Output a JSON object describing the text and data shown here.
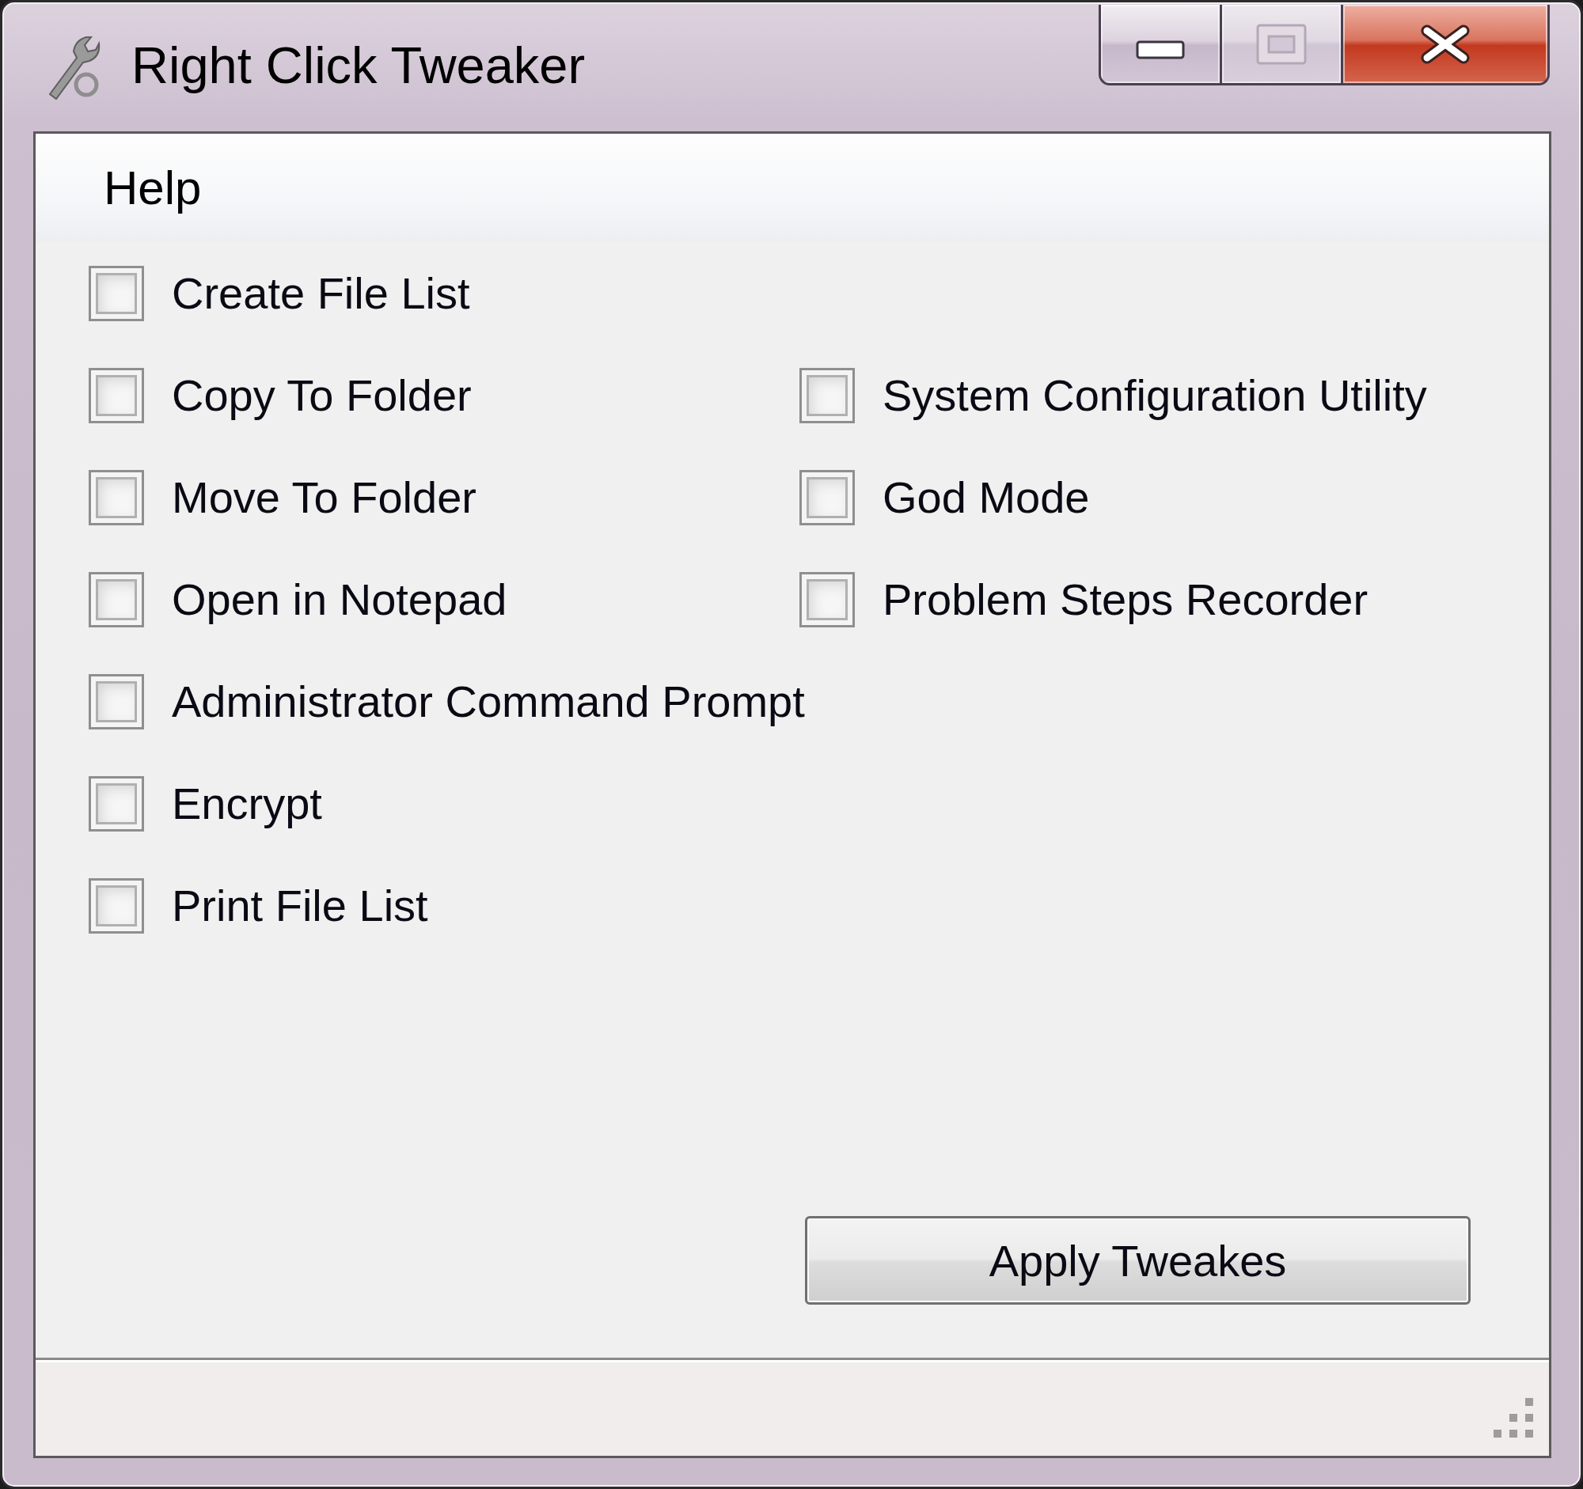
{
  "window": {
    "title": "Right Click Tweaker",
    "caption_buttons": [
      {
        "kind": "minimize",
        "disabled": false
      },
      {
        "kind": "maximize",
        "disabled": true
      },
      {
        "kind": "close",
        "disabled": false
      }
    ]
  },
  "menu_bar": {
    "items": [
      {
        "label": "Help"
      }
    ]
  },
  "checkboxes_left": [
    {
      "label": "Create File List",
      "checked": false
    },
    {
      "label": "Copy To Folder",
      "checked": false
    },
    {
      "label": "Move To Folder",
      "checked": false
    },
    {
      "label": "Open in Notepad",
      "checked": false
    },
    {
      "label": "Administrator Command Prompt",
      "checked": false
    },
    {
      "label": "Encrypt",
      "checked": false
    },
    {
      "label": "Print File List",
      "checked": false
    }
  ],
  "checkboxes_right": [
    {
      "label": "System Configuration Utility",
      "checked": false
    },
    {
      "label": "God Mode",
      "checked": false
    },
    {
      "label": "Problem Steps Recorder",
      "checked": false
    }
  ],
  "apply_button": {
    "label": "Apply Tweakes"
  }
}
